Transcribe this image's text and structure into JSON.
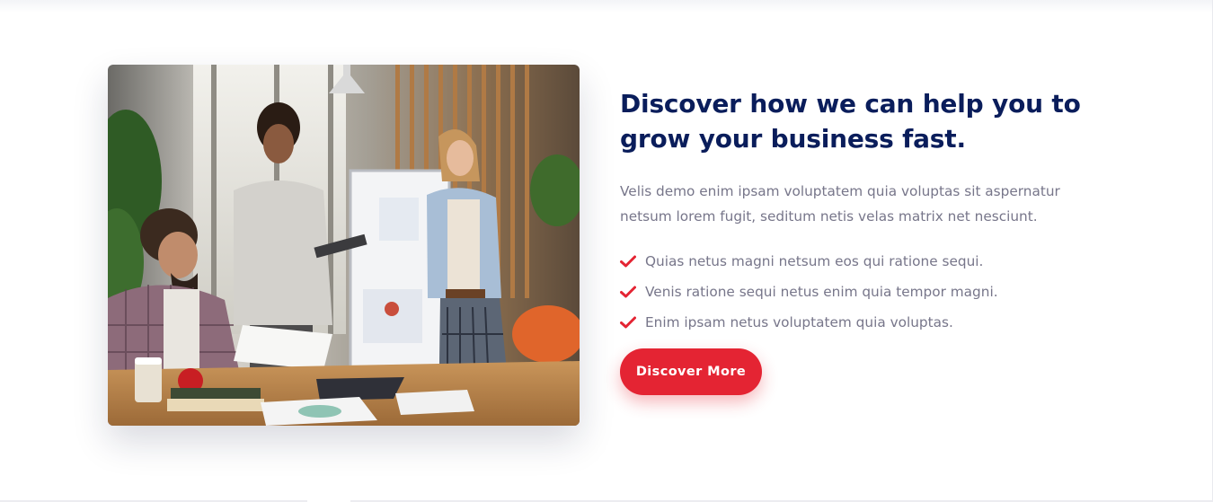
{
  "section": {
    "heading_line1": "Discover how we can help you to",
    "heading_line2": "grow your business fast.",
    "description": "Velis demo enim ipsam voluptatem quia voluptas sit aspernatur netsum lorem fugit, seditum netis velas matrix net nesciunt.",
    "features": [
      "Quias netus magni netsum eos qui ratione sequi.",
      "Venis ratione sequi netus enim quia tempor magni.",
      "Enim ipsam netus voluptatem quia voluptas."
    ],
    "cta_label": "Discover More",
    "icons": {
      "feature": "check-icon"
    }
  },
  "colors": {
    "heading": "#0a1d5b",
    "body_text": "#77768a",
    "accent": "#e42433"
  }
}
